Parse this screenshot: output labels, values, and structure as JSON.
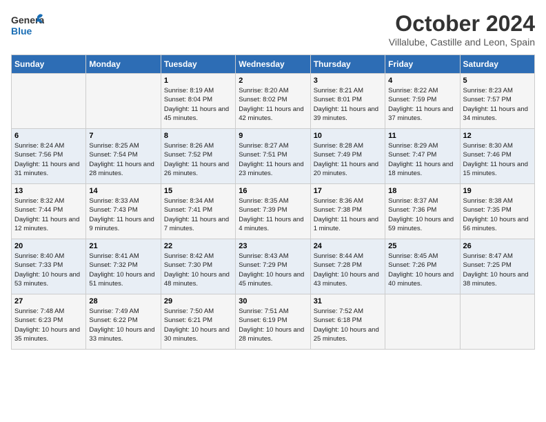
{
  "header": {
    "logo_general": "General",
    "logo_blue": "Blue",
    "month": "October 2024",
    "location": "Villalube, Castille and Leon, Spain"
  },
  "days_of_week": [
    "Sunday",
    "Monday",
    "Tuesday",
    "Wednesday",
    "Thursday",
    "Friday",
    "Saturday"
  ],
  "weeks": [
    [
      {
        "day": "",
        "sunrise": "",
        "sunset": "",
        "daylight": ""
      },
      {
        "day": "",
        "sunrise": "",
        "sunset": "",
        "daylight": ""
      },
      {
        "day": "1",
        "sunrise": "Sunrise: 8:19 AM",
        "sunset": "Sunset: 8:04 PM",
        "daylight": "Daylight: 11 hours and 45 minutes."
      },
      {
        "day": "2",
        "sunrise": "Sunrise: 8:20 AM",
        "sunset": "Sunset: 8:02 PM",
        "daylight": "Daylight: 11 hours and 42 minutes."
      },
      {
        "day": "3",
        "sunrise": "Sunrise: 8:21 AM",
        "sunset": "Sunset: 8:01 PM",
        "daylight": "Daylight: 11 hours and 39 minutes."
      },
      {
        "day": "4",
        "sunrise": "Sunrise: 8:22 AM",
        "sunset": "Sunset: 7:59 PM",
        "daylight": "Daylight: 11 hours and 37 minutes."
      },
      {
        "day": "5",
        "sunrise": "Sunrise: 8:23 AM",
        "sunset": "Sunset: 7:57 PM",
        "daylight": "Daylight: 11 hours and 34 minutes."
      }
    ],
    [
      {
        "day": "6",
        "sunrise": "Sunrise: 8:24 AM",
        "sunset": "Sunset: 7:56 PM",
        "daylight": "Daylight: 11 hours and 31 minutes."
      },
      {
        "day": "7",
        "sunrise": "Sunrise: 8:25 AM",
        "sunset": "Sunset: 7:54 PM",
        "daylight": "Daylight: 11 hours and 28 minutes."
      },
      {
        "day": "8",
        "sunrise": "Sunrise: 8:26 AM",
        "sunset": "Sunset: 7:52 PM",
        "daylight": "Daylight: 11 hours and 26 minutes."
      },
      {
        "day": "9",
        "sunrise": "Sunrise: 8:27 AM",
        "sunset": "Sunset: 7:51 PM",
        "daylight": "Daylight: 11 hours and 23 minutes."
      },
      {
        "day": "10",
        "sunrise": "Sunrise: 8:28 AM",
        "sunset": "Sunset: 7:49 PM",
        "daylight": "Daylight: 11 hours and 20 minutes."
      },
      {
        "day": "11",
        "sunrise": "Sunrise: 8:29 AM",
        "sunset": "Sunset: 7:47 PM",
        "daylight": "Daylight: 11 hours and 18 minutes."
      },
      {
        "day": "12",
        "sunrise": "Sunrise: 8:30 AM",
        "sunset": "Sunset: 7:46 PM",
        "daylight": "Daylight: 11 hours and 15 minutes."
      }
    ],
    [
      {
        "day": "13",
        "sunrise": "Sunrise: 8:32 AM",
        "sunset": "Sunset: 7:44 PM",
        "daylight": "Daylight: 11 hours and 12 minutes."
      },
      {
        "day": "14",
        "sunrise": "Sunrise: 8:33 AM",
        "sunset": "Sunset: 7:43 PM",
        "daylight": "Daylight: 11 hours and 9 minutes."
      },
      {
        "day": "15",
        "sunrise": "Sunrise: 8:34 AM",
        "sunset": "Sunset: 7:41 PM",
        "daylight": "Daylight: 11 hours and 7 minutes."
      },
      {
        "day": "16",
        "sunrise": "Sunrise: 8:35 AM",
        "sunset": "Sunset: 7:39 PM",
        "daylight": "Daylight: 11 hours and 4 minutes."
      },
      {
        "day": "17",
        "sunrise": "Sunrise: 8:36 AM",
        "sunset": "Sunset: 7:38 PM",
        "daylight": "Daylight: 11 hours and 1 minute."
      },
      {
        "day": "18",
        "sunrise": "Sunrise: 8:37 AM",
        "sunset": "Sunset: 7:36 PM",
        "daylight": "Daylight: 10 hours and 59 minutes."
      },
      {
        "day": "19",
        "sunrise": "Sunrise: 8:38 AM",
        "sunset": "Sunset: 7:35 PM",
        "daylight": "Daylight: 10 hours and 56 minutes."
      }
    ],
    [
      {
        "day": "20",
        "sunrise": "Sunrise: 8:40 AM",
        "sunset": "Sunset: 7:33 PM",
        "daylight": "Daylight: 10 hours and 53 minutes."
      },
      {
        "day": "21",
        "sunrise": "Sunrise: 8:41 AM",
        "sunset": "Sunset: 7:32 PM",
        "daylight": "Daylight: 10 hours and 51 minutes."
      },
      {
        "day": "22",
        "sunrise": "Sunrise: 8:42 AM",
        "sunset": "Sunset: 7:30 PM",
        "daylight": "Daylight: 10 hours and 48 minutes."
      },
      {
        "day": "23",
        "sunrise": "Sunrise: 8:43 AM",
        "sunset": "Sunset: 7:29 PM",
        "daylight": "Daylight: 10 hours and 45 minutes."
      },
      {
        "day": "24",
        "sunrise": "Sunrise: 8:44 AM",
        "sunset": "Sunset: 7:28 PM",
        "daylight": "Daylight: 10 hours and 43 minutes."
      },
      {
        "day": "25",
        "sunrise": "Sunrise: 8:45 AM",
        "sunset": "Sunset: 7:26 PM",
        "daylight": "Daylight: 10 hours and 40 minutes."
      },
      {
        "day": "26",
        "sunrise": "Sunrise: 8:47 AM",
        "sunset": "Sunset: 7:25 PM",
        "daylight": "Daylight: 10 hours and 38 minutes."
      }
    ],
    [
      {
        "day": "27",
        "sunrise": "Sunrise: 7:48 AM",
        "sunset": "Sunset: 6:23 PM",
        "daylight": "Daylight: 10 hours and 35 minutes."
      },
      {
        "day": "28",
        "sunrise": "Sunrise: 7:49 AM",
        "sunset": "Sunset: 6:22 PM",
        "daylight": "Daylight: 10 hours and 33 minutes."
      },
      {
        "day": "29",
        "sunrise": "Sunrise: 7:50 AM",
        "sunset": "Sunset: 6:21 PM",
        "daylight": "Daylight: 10 hours and 30 minutes."
      },
      {
        "day": "30",
        "sunrise": "Sunrise: 7:51 AM",
        "sunset": "Sunset: 6:19 PM",
        "daylight": "Daylight: 10 hours and 28 minutes."
      },
      {
        "day": "31",
        "sunrise": "Sunrise: 7:52 AM",
        "sunset": "Sunset: 6:18 PM",
        "daylight": "Daylight: 10 hours and 25 minutes."
      },
      {
        "day": "",
        "sunrise": "",
        "sunset": "",
        "daylight": ""
      },
      {
        "day": "",
        "sunrise": "",
        "sunset": "",
        "daylight": ""
      }
    ]
  ]
}
